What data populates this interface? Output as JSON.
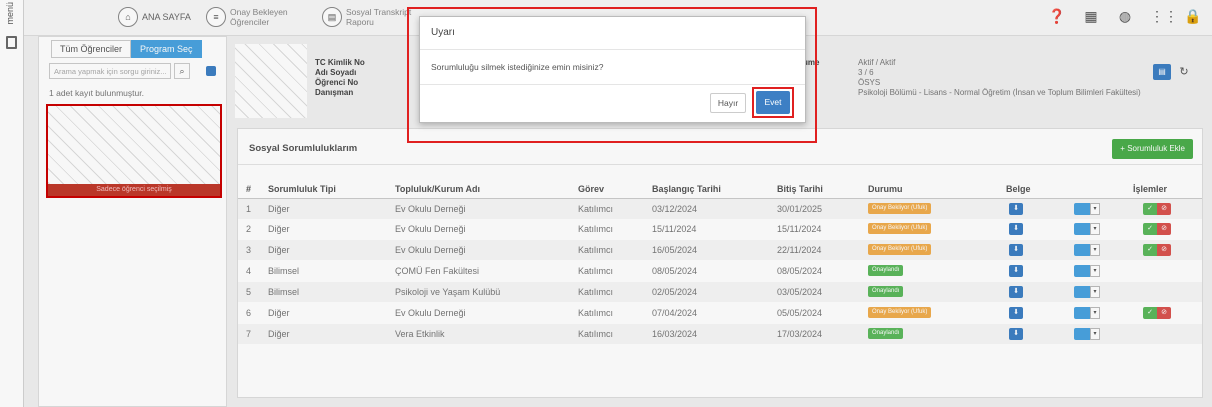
{
  "sidebar": {
    "menu_label": "menü"
  },
  "header": {
    "home_label": "ANA SAYFA",
    "pending_line1": "Onay Bekleyen",
    "pending_line2": "Öğrenciler",
    "transcript_line1": "Sosyal Transkript",
    "transcript_line2": "Raporu",
    "icons": [
      "help-icon",
      "calendar-icon",
      "globe-icon",
      "apps-grid-icon",
      "lock-icon"
    ]
  },
  "left_panel": {
    "tab_all": "Tüm Öğrenciler",
    "tab_program": "Program Seç",
    "search_placeholder": "Arama yapmak için sorgu giriniz...",
    "record_count": "1 adet kayıt bulunmuştur.",
    "photo_caption": "Sadece öğrenci seçilmiş"
  },
  "student": {
    "label_tc": "TC Kimlik No",
    "label_name": "Adı Soyadı",
    "label_no": "Öğrenci No",
    "label_program": "Danışman",
    "right_partial": "ume",
    "status": "Aktif / Aktif",
    "class": "3 / 6",
    "type": "ÖSYS",
    "program": "Psikoloji Bölümü - Lisans - Normal Öğretim (İnsan ve Toplum Bilimleri Fakültesi)"
  },
  "main": {
    "title": "Sosyal Sorumluluklarım",
    "add_button": "Sorumluluk Ekle",
    "columns": [
      "#",
      "Sorumluluk Tipi",
      "Topluluk/Kurum Adı",
      "Görev",
      "Başlangıç Tarihi",
      "Bitiş Tarihi",
      "Durumu",
      "Belge",
      "İşlemler"
    ],
    "rows": [
      {
        "no": "1",
        "type": "Diğer",
        "org": "Ev Okulu Derneği",
        "role": "Katılımcı",
        "start": "03/12/2024",
        "end": "30/01/2025",
        "status": "Onay Bekliyor (Ufuk)"
      },
      {
        "no": "2",
        "type": "Diğer",
        "org": "Ev Okulu Derneği",
        "role": "Katılımcı",
        "start": "15/11/2024",
        "end": "15/11/2024",
        "status": "Onay Bekliyor (Ufuk)"
      },
      {
        "no": "3",
        "type": "Diğer",
        "org": "Ev Okulu Derneği",
        "role": "Katılımcı",
        "start": "16/05/2024",
        "end": "22/11/2024",
        "status": "Onay Bekliyor (Ufuk)"
      },
      {
        "no": "4",
        "type": "Bilimsel",
        "org": "ÇOMÜ Fen Fakültesi",
        "role": "Katılımcı",
        "start": "08/05/2024",
        "end": "08/05/2024",
        "status": "Onaylandı"
      },
      {
        "no": "5",
        "type": "Bilimsel",
        "org": "Psikoloji ve Yaşam Kulübü",
        "role": "Katılımcı",
        "start": "02/05/2024",
        "end": "03/05/2024",
        "status": "Onaylandı"
      },
      {
        "no": "6",
        "type": "Diğer",
        "org": "Ev Okulu Derneği",
        "role": "Katılımcı",
        "start": "07/04/2024",
        "end": "05/05/2024",
        "status": "Onay Bekliyor (Ufuk)"
      },
      {
        "no": "7",
        "type": "Diğer",
        "org": "Vera Etkinlik",
        "role": "Katılımcı",
        "start": "16/03/2024",
        "end": "17/03/2024",
        "status": "Onaylandı"
      }
    ]
  },
  "modal": {
    "title": "Uyarı",
    "message": "Sorumluluğu silmek istediğinize emin misiniz?",
    "cancel": "Hayır",
    "confirm": "Evet"
  },
  "colors": {
    "primary": "#3d7fc4",
    "info": "#4aa3df",
    "success": "#5cb85c",
    "warning": "#f0ad4e",
    "danger": "#d9534f",
    "highlight": "#e02020"
  }
}
